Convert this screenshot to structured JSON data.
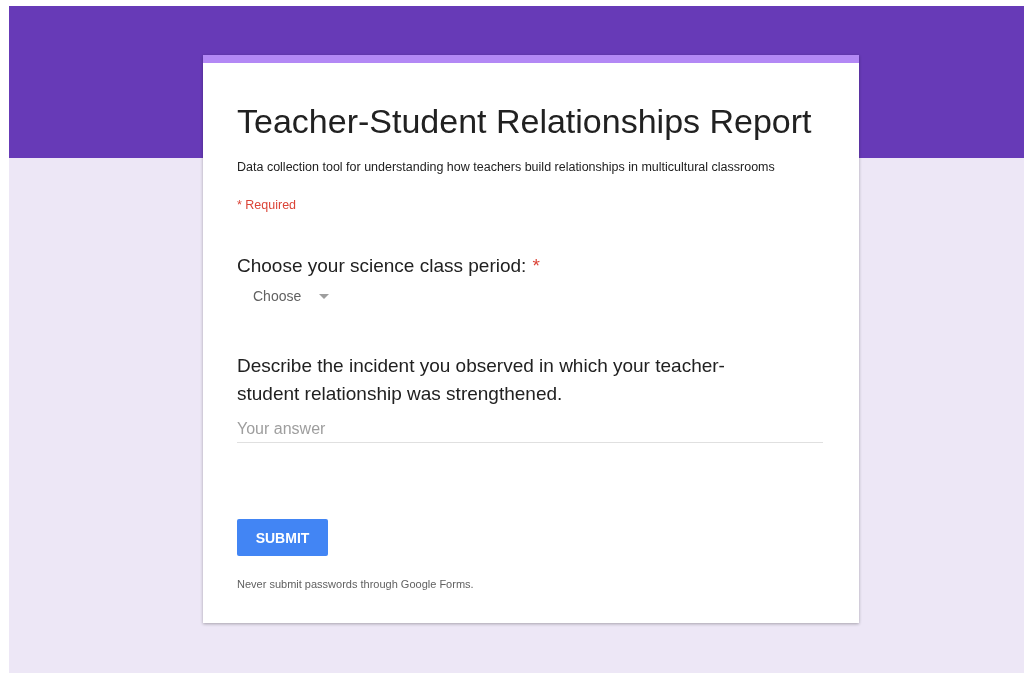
{
  "form": {
    "title": "Teacher-Student Relationships Report",
    "description": "Data collection tool for understanding how teachers build relationships in multicultural classrooms",
    "required_note": "* Required"
  },
  "questions": [
    {
      "kind": "dropdown",
      "label": "Choose your science class period:",
      "required": true,
      "placeholder": "Choose"
    },
    {
      "kind": "text",
      "label": "Describe the incident you observed in which your teacher-student relationship was strengthened.",
      "required": false,
      "placeholder": "Your answer"
    }
  ],
  "submit": {
    "label": "SUBMIT"
  },
  "required_marker": "*",
  "footer_note": "Never submit passwords through Google Forms."
}
